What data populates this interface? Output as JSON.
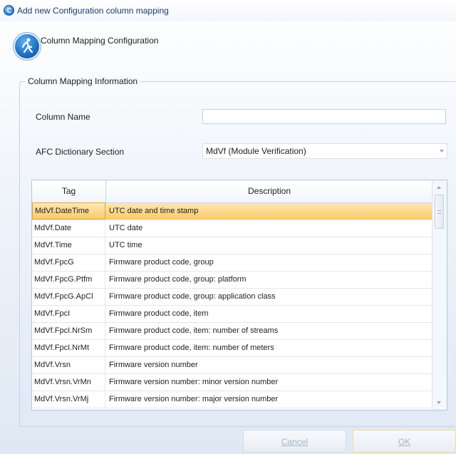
{
  "window": {
    "title": "Add new Configuration column mapping"
  },
  "header": {
    "title": "Column Mapping Configuration"
  },
  "group": {
    "legend": "Column Mapping Information"
  },
  "fields": {
    "column_name_label": "Column Name",
    "column_name_value": "",
    "section_label": "AFC Dictionary Section",
    "section_value": "MdVf (Module Verification)"
  },
  "grid": {
    "columns": [
      "Tag",
      "Description"
    ],
    "rows": [
      {
        "tag": "MdVf.DateTime",
        "desc": "UTC date and time stamp",
        "selected": true
      },
      {
        "tag": "MdVf.Date",
        "desc": "UTC date"
      },
      {
        "tag": "MdVf.Time",
        "desc": "UTC time"
      },
      {
        "tag": "MdVf.FpcG",
        "desc": "Firmware product code, group"
      },
      {
        "tag": "MdVf.FpcG.Ptfm",
        "desc": "Firmware product code, group: platform"
      },
      {
        "tag": "MdVf.FpcG.ApCl",
        "desc": "Firmware product code, group: application class"
      },
      {
        "tag": "MdVf.FpcI",
        "desc": "Firmware product code, item"
      },
      {
        "tag": "MdVf.FpcI.NrSm",
        "desc": "Firmware product code, item: number of streams"
      },
      {
        "tag": "MdVf.FpcI.NrMt",
        "desc": "Firmware product code, item: number of meters"
      },
      {
        "tag": "MdVf.Vrsn",
        "desc": "Firmware version number"
      },
      {
        "tag": "MdVf.Vrsn.VrMn",
        "desc": "Firmware version number: minor version number"
      },
      {
        "tag": "MdVf.Vrsn.VrMj",
        "desc": "Firmware version number: major version number"
      }
    ]
  },
  "buttons": {
    "cancel": "Cancel",
    "ok": "OK"
  }
}
